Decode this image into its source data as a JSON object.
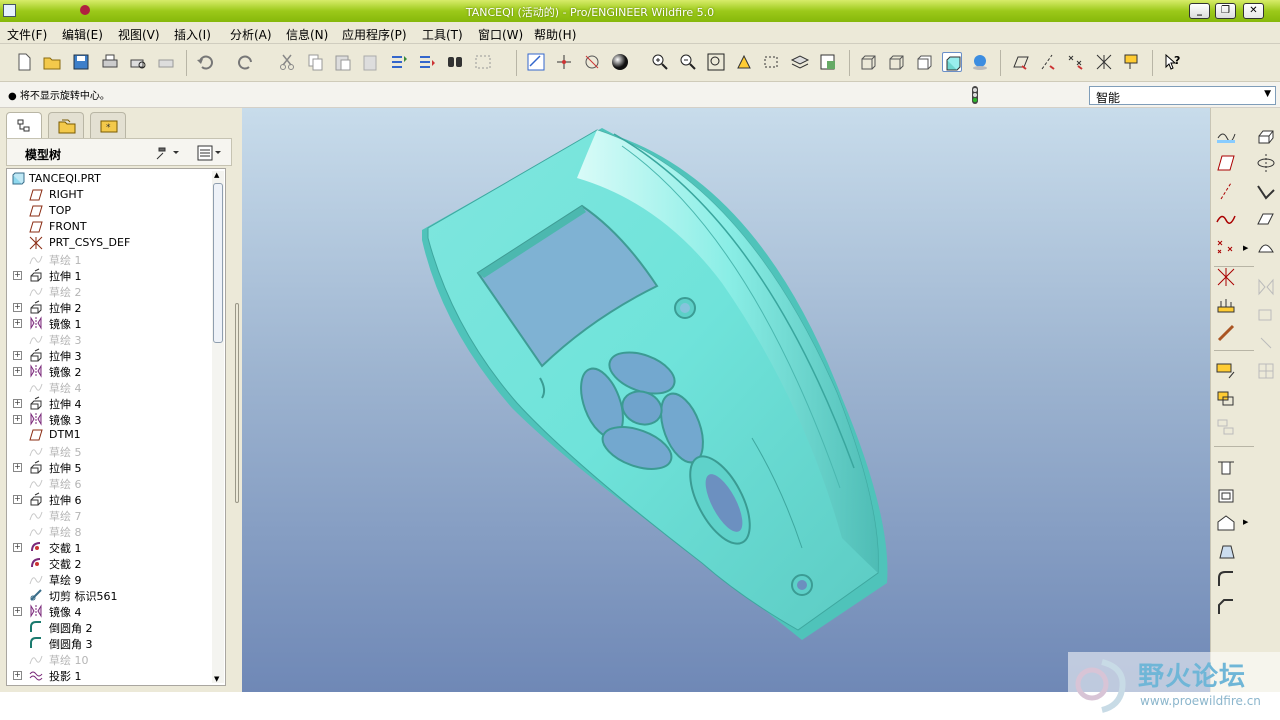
{
  "window": {
    "title": "TANCEQI (活动的) - Pro/ENGINEER Wildfire 5.0"
  },
  "menu": [
    "文件(F)",
    "编辑(E)",
    "视图(V)",
    "插入(I)",
    "分析(A)",
    "信息(N)",
    "应用程序(P)",
    "工具(T)",
    "窗口(W)",
    "帮助(H)"
  ],
  "message": "● 将不显示旋转中心。",
  "filter": {
    "value": "智能"
  },
  "model_tree": {
    "title": "模型树",
    "items": [
      {
        "label": "TANCEQI.PRT",
        "icon": "part-icon",
        "dim": false,
        "exp": false,
        "level": 0
      },
      {
        "label": "RIGHT",
        "icon": "datum-plane-icon",
        "dim": false,
        "exp": false,
        "level": 1
      },
      {
        "label": "TOP",
        "icon": "datum-plane-icon",
        "dim": false,
        "exp": false,
        "level": 1
      },
      {
        "label": "FRONT",
        "icon": "datum-plane-icon",
        "dim": false,
        "exp": false,
        "level": 1
      },
      {
        "label": "PRT_CSYS_DEF",
        "icon": "csys-icon",
        "dim": false,
        "exp": false,
        "level": 1
      },
      {
        "label": "草绘 1",
        "icon": "sketch-icon",
        "dim": true,
        "exp": false,
        "level": 1
      },
      {
        "label": "拉伸 1",
        "icon": "extrude-icon",
        "dim": false,
        "exp": true,
        "level": 1
      },
      {
        "label": "草绘 2",
        "icon": "sketch-icon",
        "dim": true,
        "exp": false,
        "level": 1
      },
      {
        "label": "拉伸 2",
        "icon": "extrude-icon",
        "dim": false,
        "exp": true,
        "level": 1
      },
      {
        "label": "镜像 1",
        "icon": "mirror-icon",
        "dim": false,
        "exp": true,
        "level": 1
      },
      {
        "label": "草绘 3",
        "icon": "sketch-icon",
        "dim": true,
        "exp": false,
        "level": 1
      },
      {
        "label": "拉伸 3",
        "icon": "extrude-icon",
        "dim": false,
        "exp": true,
        "level": 1
      },
      {
        "label": "镜像 2",
        "icon": "mirror-icon",
        "dim": false,
        "exp": true,
        "level": 1
      },
      {
        "label": "草绘 4",
        "icon": "sketch-icon",
        "dim": true,
        "exp": false,
        "level": 1
      },
      {
        "label": "拉伸 4",
        "icon": "extrude-icon",
        "dim": false,
        "exp": true,
        "level": 1
      },
      {
        "label": "镜像 3",
        "icon": "mirror-icon",
        "dim": false,
        "exp": true,
        "level": 1
      },
      {
        "label": "DTM1",
        "icon": "datum-plane-icon",
        "dim": false,
        "exp": false,
        "level": 1
      },
      {
        "label": "草绘 5",
        "icon": "sketch-icon",
        "dim": true,
        "exp": false,
        "level": 1
      },
      {
        "label": "拉伸 5",
        "icon": "extrude-icon",
        "dim": false,
        "exp": true,
        "level": 1
      },
      {
        "label": "草绘 6",
        "icon": "sketch-icon",
        "dim": true,
        "exp": false,
        "level": 1
      },
      {
        "label": "拉伸 6",
        "icon": "extrude-icon",
        "dim": false,
        "exp": true,
        "level": 1
      },
      {
        "label": "草绘 7",
        "icon": "sketch-icon",
        "dim": true,
        "exp": false,
        "level": 1
      },
      {
        "label": "草绘 8",
        "icon": "sketch-icon",
        "dim": true,
        "exp": false,
        "level": 1
      },
      {
        "label": "交截 1",
        "icon": "intersect-icon",
        "dim": false,
        "exp": true,
        "level": 1
      },
      {
        "label": "交截 2",
        "icon": "intersect-icon",
        "dim": false,
        "exp": false,
        "level": 1
      },
      {
        "label": "草绘 9",
        "icon": "sketch-icon",
        "dim": false,
        "exp": false,
        "level": 1
      },
      {
        "label": "切剪 标识561",
        "icon": "cut-icon",
        "dim": false,
        "exp": false,
        "level": 1
      },
      {
        "label": "镜像 4",
        "icon": "mirror-icon",
        "dim": false,
        "exp": true,
        "level": 1
      },
      {
        "label": "倒圆角 2",
        "icon": "round-icon",
        "dim": false,
        "exp": false,
        "level": 1
      },
      {
        "label": "倒圆角 3",
        "icon": "round-icon",
        "dim": false,
        "exp": false,
        "level": 1
      },
      {
        "label": "草绘 10",
        "icon": "sketch-icon",
        "dim": true,
        "exp": false,
        "level": 1
      },
      {
        "label": "投影 1",
        "icon": "projection-icon",
        "dim": false,
        "exp": true,
        "level": 1
      }
    ]
  },
  "watermark": {
    "title": "野火论坛",
    "url": "www.proewildfire.cn"
  },
  "colors": {
    "titlebar": "#9cc91a",
    "model": "#78e8dc",
    "viewport_top": "#c8dceb",
    "viewport_bottom": "#6f88b6"
  }
}
